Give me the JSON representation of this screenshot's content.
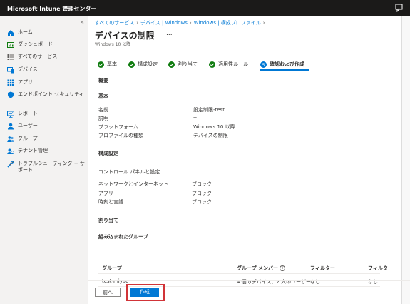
{
  "app": {
    "title": "Microsoft Intune 管理センター"
  },
  "colors": {
    "topbar": "#1b1a19",
    "accent": "#0078d4",
    "success": "#107c10",
    "highlight": "#d13438"
  },
  "sidebar": {
    "collapse_icon": "«",
    "items": [
      {
        "label": "ホーム",
        "icon": "home-icon"
      },
      {
        "label": "ダッシュボード",
        "icon": "dashboard-icon"
      },
      {
        "label": "すべてのサービス",
        "icon": "list-icon"
      },
      {
        "label": "デバイス",
        "icon": "devices-icon"
      },
      {
        "label": "アプリ",
        "icon": "apps-icon"
      },
      {
        "label": "エンドポイント セキュリティ",
        "icon": "shield-icon"
      },
      {
        "label": "レポート",
        "icon": "reports-icon"
      },
      {
        "label": "ユーザー",
        "icon": "user-icon"
      },
      {
        "label": "グループ",
        "icon": "groups-icon"
      },
      {
        "label": "テナント管理",
        "icon": "tenant-icon"
      },
      {
        "label": "トラブルシューティング + サポート",
        "icon": "troubleshoot-icon"
      }
    ]
  },
  "breadcrumb": [
    "すべてのサービス",
    "デバイス | Windows",
    "Windows | 構成プロファイル"
  ],
  "page": {
    "title": "デバイスの制限",
    "more": "...",
    "subtitle": "Windows 10 以降"
  },
  "steps": [
    {
      "label": "基本",
      "state": "done"
    },
    {
      "label": "構成設定",
      "state": "done"
    },
    {
      "label": "割り当て",
      "state": "done"
    },
    {
      "label": "適用性ルール",
      "state": "done"
    },
    {
      "label": "確認および作成",
      "state": "current",
      "number": "5"
    }
  ],
  "review": {
    "overview": "概要",
    "basics": {
      "heading": "基本",
      "rows": [
        {
          "key": "名前",
          "value": "設定制限-test"
        },
        {
          "key": "説明",
          "value": "--"
        },
        {
          "key": "プラットフォーム",
          "value": "Windows 10 以降"
        },
        {
          "key": "プロファイルの種類",
          "value": "デバイスの制限"
        }
      ]
    },
    "config": {
      "heading": "構成設定",
      "subheading": "コントロール パネルと設定",
      "rows": [
        {
          "key": "ネットワークとインターネット",
          "value": "ブロック"
        },
        {
          "key": "アプリ",
          "value": "ブロック"
        },
        {
          "key": "時刻と言語",
          "value": "ブロック"
        }
      ]
    },
    "assignments": {
      "heading": "割り当て",
      "included_heading": "組み込まれたグループ",
      "columns": [
        "グループ",
        "グループ メンバー",
        "フィルター",
        "フィルタ"
      ],
      "rows": [
        {
          "group": "test-miyao",
          "members": "4 個のデバイス、2 人のユーザー",
          "filter": "なし",
          "filter_mode": "なし"
        }
      ]
    }
  },
  "footer": {
    "prev": "前へ",
    "create": "作成"
  }
}
